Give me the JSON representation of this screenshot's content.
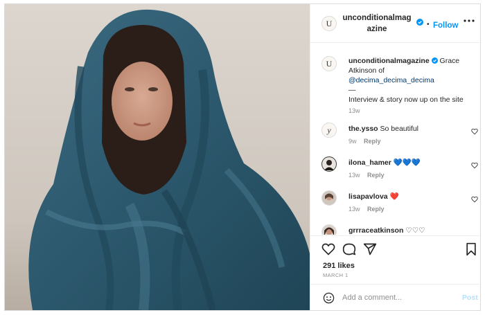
{
  "header": {
    "username": "unconditionalmagazine",
    "avatar_letter": "U",
    "verified_icon": "verified-badge-icon",
    "separator": "•",
    "follow_label": "Follow",
    "more_icon": "more-options-icon"
  },
  "caption": {
    "username": "unconditionalmagazine",
    "text_before": "Grace Atkinson of",
    "mention": "@decima_decima_decima",
    "dash": "—",
    "text_after": "Interview & story now up on the site",
    "time": "13w"
  },
  "comments": [
    {
      "username": "the.ysso",
      "text": "So beautiful",
      "time": "9w",
      "reply": "Reply",
      "avatar_letter": "y"
    },
    {
      "username": "ilona_hamer",
      "text": "💙💙💙",
      "time": "13w",
      "reply": "Reply",
      "avatar_letter": ""
    },
    {
      "username": "lisapavlova",
      "text": "❤️",
      "time": "13w",
      "reply": "Reply",
      "avatar_letter": ""
    },
    {
      "username": "grrraceatkinson",
      "text": "♡♡♡",
      "time": "",
      "reply": "",
      "avatar_letter": ""
    }
  ],
  "actions": {
    "likes": "291 likes",
    "date": "MARCH 1",
    "icons": [
      "heart-icon",
      "comment-icon",
      "share-icon",
      "bookmark-icon"
    ]
  },
  "add_comment": {
    "placeholder": "Add a comment...",
    "post_label": "Post",
    "emoji_icon": "emoji-icon"
  },
  "colors": {
    "link": "#0095f6",
    "mention": "#00376b",
    "muted": "#8e8e8e",
    "blanket": "#2f5a6e"
  }
}
